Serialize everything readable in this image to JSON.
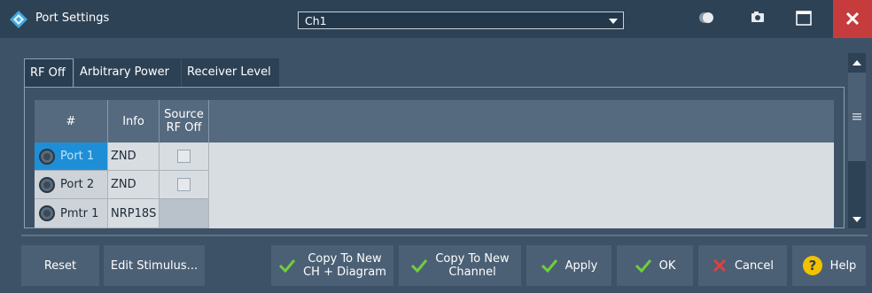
{
  "window": {
    "title": "Port Settings",
    "channel_select": {
      "value": "Ch1"
    },
    "icons": [
      "toggle-icon",
      "camera-icon",
      "maximize-icon",
      "close-icon"
    ]
  },
  "tabs": [
    {
      "label": "RF Off",
      "active": true
    },
    {
      "label": "Arbitrary Power",
      "active": false
    },
    {
      "label": "Receiver Level",
      "active": false
    }
  ],
  "table": {
    "headers": [
      "#",
      "Info",
      "Source RF Off"
    ],
    "rows": [
      {
        "port": "Port 1",
        "info": "ZND",
        "source_rf_off": false,
        "selected": true
      },
      {
        "port": "Port 2",
        "info": "ZND",
        "source_rf_off": false,
        "selected": false
      },
      {
        "port": "Pmtr 1",
        "info": "NRP18S",
        "source_rf_off": null,
        "selected": false
      }
    ]
  },
  "buttons": {
    "reset": "Reset",
    "edit_stimulus": "Edit Stimulus...",
    "copy_new_ch_diagram": "Copy To New\nCH + Diagram",
    "copy_new_channel": "Copy To New\nChannel",
    "apply": "Apply",
    "ok": "OK",
    "cancel": "Cancel",
    "help": "Help"
  },
  "colors": {
    "accent_blue": "#1e8fd6",
    "check_green": "#6fcf3a",
    "cancel_red": "#e04040",
    "help_yellow": "#f2c200",
    "close_red": "#c63c3c"
  }
}
